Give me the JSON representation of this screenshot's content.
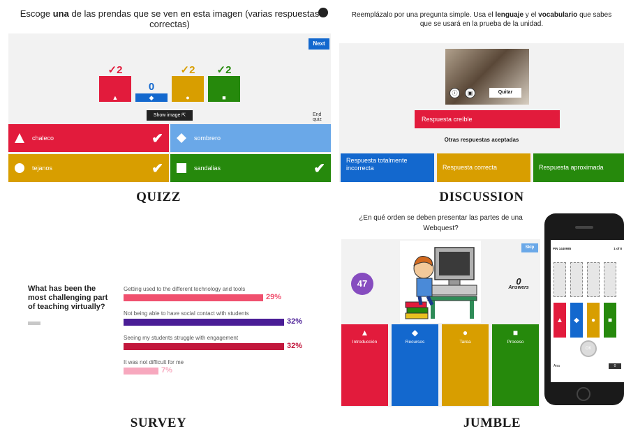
{
  "quizz": {
    "question_pre": "Escoge",
    "question_bold": "una",
    "question_post": "de las prendas que se ven en esta imagen (varias respuestas correctas)",
    "next_label": "Next",
    "show_image_label": "Show image ⇱",
    "end_quiz_label": "End quiz",
    "counts": [
      {
        "marker": "✓",
        "value": "2",
        "color": "#e21b3c",
        "foot": "▲",
        "level": 0.62
      },
      {
        "marker": "",
        "value": "0",
        "color": "#1368ce",
        "foot": "◆",
        "level": 0.0
      },
      {
        "marker": "✓",
        "value": "2",
        "color": "#d89e00",
        "foot": "●",
        "level": 0.62
      },
      {
        "marker": "✓",
        "value": "2",
        "color": "#26890c",
        "foot": "■",
        "level": 0.62
      }
    ],
    "answers": [
      {
        "label": "chaleco",
        "shape": "triangle",
        "color": "#e21b3c",
        "check": "✔"
      },
      {
        "label": "sombrero",
        "shape": "diamond",
        "color": "#6aa8e8",
        "check": ""
      },
      {
        "label": "tejanos",
        "shape": "circle",
        "color": "#d89e00",
        "check": "✔"
      },
      {
        "label": "sandalias",
        "shape": "square",
        "color": "#26890c",
        "check": "✔"
      }
    ],
    "caption": "QUIZZ"
  },
  "discussion": {
    "instruction_pre": "Reemplázalo por una pregunta simple. Usa el",
    "instruction_b1": "lenguaje",
    "instruction_mid": "y el",
    "instruction_b2": "vocabulario",
    "instruction_post": "que sabes que se usará en la prueba de la unidad.",
    "info_icon": "ⓘ",
    "image_icon": "▣",
    "remove_label": "Quitar",
    "main_answer": "Respuesta creíble",
    "other_answers_heading": "Otras respuestas aceptadas",
    "answers": [
      {
        "label": "Respuesta totalmente incorrecta",
        "color": "#1368ce"
      },
      {
        "label": "Respuesta correcta",
        "color": "#d89e00"
      },
      {
        "label": "Respuesta aproximada",
        "color": "#26890c"
      }
    ],
    "caption": "DISCUSSION"
  },
  "survey": {
    "question": "What has been the most challenging part of teaching virtually?",
    "items": [
      {
        "label": "Getting used to the different technology and tools",
        "pct_text": "29%",
        "value": 29,
        "color": "#f0506e"
      },
      {
        "label": "Not being able to have social contact with students",
        "pct_text": "32%",
        "value": 32,
        "color": "#4a1d96"
      },
      {
        "label": "Seeing my students struggle with engagement",
        "pct_text": "32%",
        "value": 32,
        "color": "#c2173c"
      },
      {
        "label": "It was not difficult for me",
        "pct_text": "7%",
        "value": 7,
        "color": "#f7a8be"
      }
    ],
    "caption": "SURVEY"
  },
  "jumble": {
    "question": "¿En qué orden se deben presentar las partes de una Webquest?",
    "skip_label": "Skip",
    "timer": "47",
    "answers_count": "0",
    "answers_label": "Answers",
    "cards": [
      {
        "label": "Introducción",
        "shape": "▲",
        "color": "#e21b3c"
      },
      {
        "label": "Recursos",
        "shape": "◆",
        "color": "#1368ce"
      },
      {
        "label": "Tarea",
        "shape": "●",
        "color": "#d89e00"
      },
      {
        "label": "Proceso",
        "shape": "■",
        "color": "#26890c"
      }
    ],
    "caption": "JUMBLE"
  },
  "phone": {
    "pin": "PIN 1440985",
    "page": "1 of 8",
    "ok_label": "OK",
    "player_name": "Ana",
    "score": "0",
    "tiles": [
      {
        "shape": "▲",
        "color": "#e21b3c"
      },
      {
        "shape": "◆",
        "color": "#1368ce"
      },
      {
        "shape": "●",
        "color": "#d89e00"
      },
      {
        "shape": "■",
        "color": "#26890c"
      }
    ]
  }
}
